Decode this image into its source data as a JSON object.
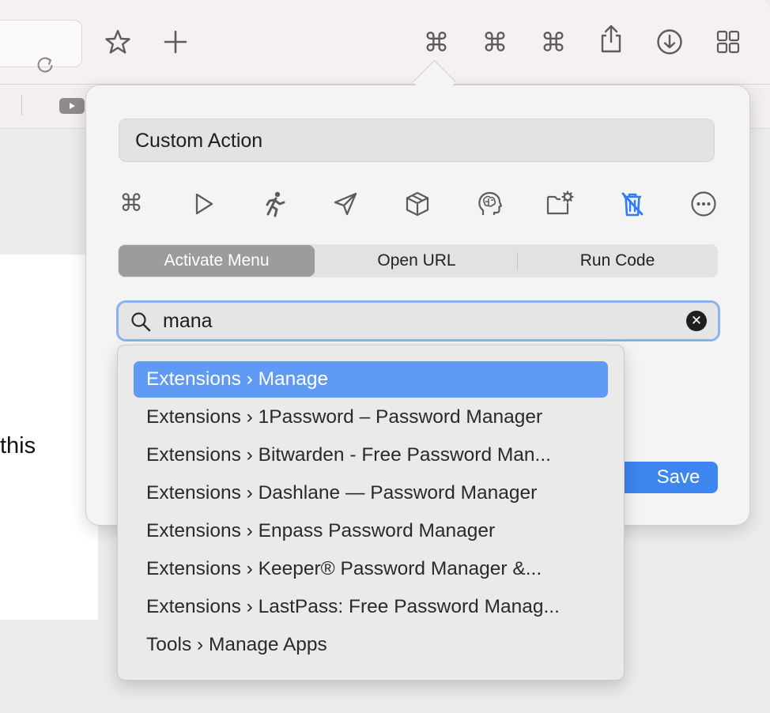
{
  "browser": {
    "toolbar_buttons": [
      {
        "name": "reload-icon"
      },
      {
        "name": "bookmark-star-icon"
      },
      {
        "name": "new-tab-plus-icon"
      },
      {
        "name": "command-icon",
        "glyph": "⌘"
      },
      {
        "name": "command-icon",
        "glyph": "⌘"
      },
      {
        "name": "command-icon",
        "glyph": "⌘"
      },
      {
        "name": "share-icon"
      },
      {
        "name": "download-icon"
      },
      {
        "name": "tab-overview-grid-icon"
      }
    ],
    "command_glyph": "⌘",
    "page_text_fragment": "this"
  },
  "popover": {
    "title_value": "Custom Action",
    "action_types": [
      {
        "icon": "command-icon",
        "glyph": "⌘",
        "selected": false
      },
      {
        "icon": "play-icon",
        "selected": false
      },
      {
        "icon": "running-figure-icon",
        "selected": false
      },
      {
        "icon": "paper-plane-icon",
        "selected": false
      },
      {
        "icon": "cube-icon",
        "selected": false
      },
      {
        "icon": "brain-head-icon",
        "selected": false
      },
      {
        "icon": "folder-gear-icon",
        "selected": false
      },
      {
        "icon": "trash-slash-icon",
        "selected": true
      },
      {
        "icon": "more-ellipsis-icon",
        "selected": false
      }
    ],
    "segments": [
      "Activate Menu",
      "Open URL",
      "Run Code"
    ],
    "selected_segment": "Activate Menu",
    "search": {
      "value": "mana",
      "clear_glyph": "✕"
    },
    "save_label": "Save",
    "suggestions": [
      "Extensions › Manage",
      "Extensions › 1Password – Password Manager",
      "Extensions › Bitwarden - Free Password Man...",
      "Extensions › Dashlane — Password Manager",
      "Extensions › Enpass Password Manager",
      "Extensions › Keeper® Password Manager &...",
      "Extensions › LastPass: Free Password Manag...",
      "Tools › Manage Apps"
    ],
    "selected_suggestion": "Extensions › Manage"
  },
  "colors": {
    "accent": "#3d86f0",
    "selection": "#5f9af5",
    "segment_active": "#9d9c9c",
    "search_focus_ring": "#8cb0f3",
    "icon_gray": "#5f5b5b",
    "selected_icon": "#2f7cf6"
  }
}
